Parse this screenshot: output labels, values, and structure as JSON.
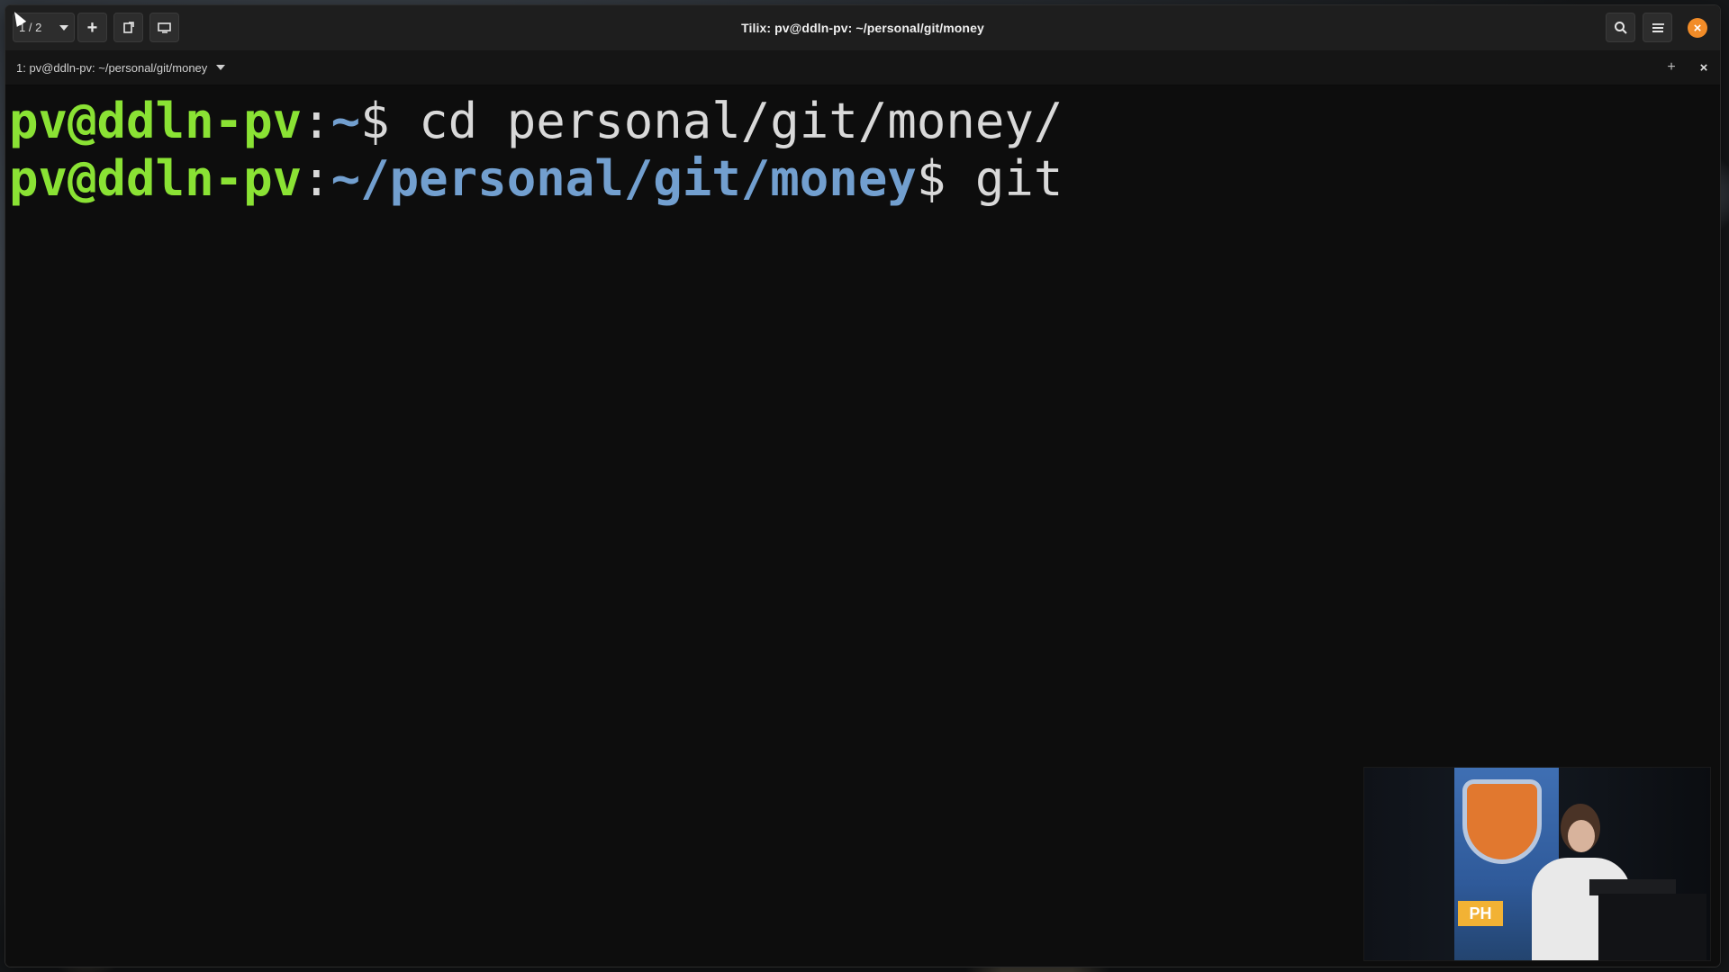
{
  "window": {
    "title": "Tilix: pv@ddln-pv: ~/personal/git/money"
  },
  "toolbar": {
    "session_switcher": "1 / 2",
    "add_label": "+"
  },
  "terminal_tab": {
    "title": "1: pv@ddln-pv: ~/personal/git/money"
  },
  "terminal": {
    "lines": [
      {
        "user": "pv@ddln-pv",
        "sep": ":",
        "path": "~",
        "prompt": "$ ",
        "command": "cd personal/git/money/"
      },
      {
        "user": "pv@ddln-pv",
        "sep": ":",
        "path": "~/personal/git/money",
        "prompt": "$ ",
        "command": "git"
      }
    ]
  },
  "colors": {
    "user": "#8ae234",
    "path": "#729fcf",
    "close_button": "#f28c28",
    "background": "#0d0d0d"
  },
  "icons": {
    "session_dropdown": "chevron-down-icon",
    "add_terminal": "plus-icon",
    "split": "split-terminal-icon",
    "sync_input": "sync-input-icon",
    "search": "search-icon",
    "menu": "hamburger-menu-icon",
    "minimize": "minimize-icon",
    "close": "close-icon"
  }
}
